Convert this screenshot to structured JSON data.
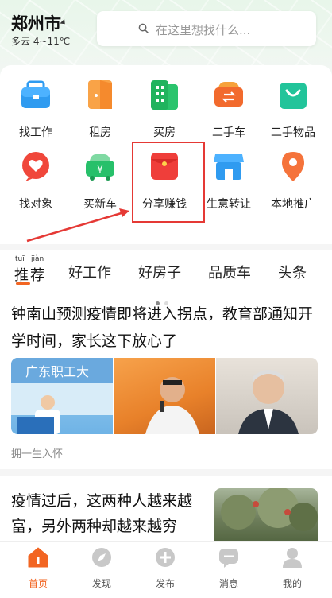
{
  "header": {
    "city": "郑州市",
    "weather": "多云 4~11℃",
    "search_placeholder": "在这里想找什么..."
  },
  "grid": {
    "items": [
      {
        "label": "找工作",
        "icon": "briefcase-icon",
        "color": "#2f9bf0"
      },
      {
        "label": "租房",
        "icon": "door-icon",
        "color": "#f58a2d"
      },
      {
        "label": "买房",
        "icon": "building-icon",
        "color": "#2bc46d"
      },
      {
        "label": "二手车",
        "icon": "car-swap-icon",
        "color": "#f26a2d"
      },
      {
        "label": "二手物品",
        "icon": "shopping-bag-icon",
        "color": "#22c49a"
      },
      {
        "label": "找对象",
        "icon": "heart-chat-icon",
        "color": "#f0473b"
      },
      {
        "label": "买新车",
        "icon": "new-car-icon",
        "color": "#27c06a"
      },
      {
        "label": "分享赚钱",
        "icon": "red-envelope-icon",
        "color": "#ef3e3a"
      },
      {
        "label": "生意转让",
        "icon": "shop-icon",
        "color": "#2f9bf0"
      },
      {
        "label": "本地推广",
        "icon": "location-pin-icon",
        "color": "#f5733b"
      }
    ]
  },
  "tabs": {
    "recommend_pinyin_1": "tuī",
    "recommend_pinyin_2": "jiàn",
    "recommend_char_1": "推",
    "recommend_char_2": "荐",
    "items": [
      "好工作",
      "好房子",
      "品质车",
      "头条"
    ],
    "accent": "#f26522"
  },
  "feed": {
    "article1": {
      "title": "钟南山预测疫情即将进入拐点，教育部通知开学时间，家长这下放心了",
      "image1_caption": "广东职工大",
      "source": "拥一生入怀"
    },
    "article2": {
      "title": "疫情过后，这两种人越来越富，另外两种却越来越穷"
    }
  },
  "nav": {
    "items": [
      {
        "label": "首页",
        "icon": "home-icon",
        "active": true
      },
      {
        "label": "发现",
        "icon": "compass-icon",
        "active": false
      },
      {
        "label": "发布",
        "icon": "plus-icon",
        "active": false
      },
      {
        "label": "消息",
        "icon": "message-icon",
        "active": false
      },
      {
        "label": "我的",
        "icon": "user-icon",
        "active": false
      }
    ]
  }
}
